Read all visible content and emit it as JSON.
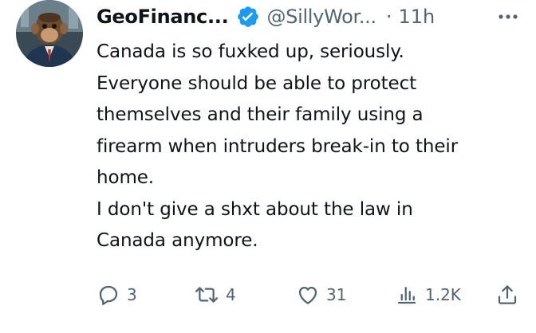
{
  "tweet": {
    "display_name": "GeoFinanc...",
    "handle": "@SillyWor...",
    "separator": "·",
    "time": "11h",
    "text_lines": [
      "Canada is so fuxked up, seriously.",
      "Everyone should be able to protect",
      "themselves and their family using a",
      "firearm when intruders break-in to their",
      "home.",
      "I don't give a shxt about the law in",
      "Canada anymore."
    ],
    "actions": {
      "reply_count": "3",
      "retweet_count": "4",
      "like_count": "31",
      "view_count": "1.2K"
    }
  },
  "icons": {
    "avatar": "monkey-in-suit-avatar",
    "verified": "verified-badge-icon",
    "more": "more-options-icon",
    "reply": "reply-icon",
    "retweet": "retweet-icon",
    "like": "heart-icon",
    "views": "views-icon",
    "share": "share-icon"
  },
  "colors": {
    "text": "#0f1419",
    "muted": "#536471",
    "verified": "#1d9bf0"
  }
}
